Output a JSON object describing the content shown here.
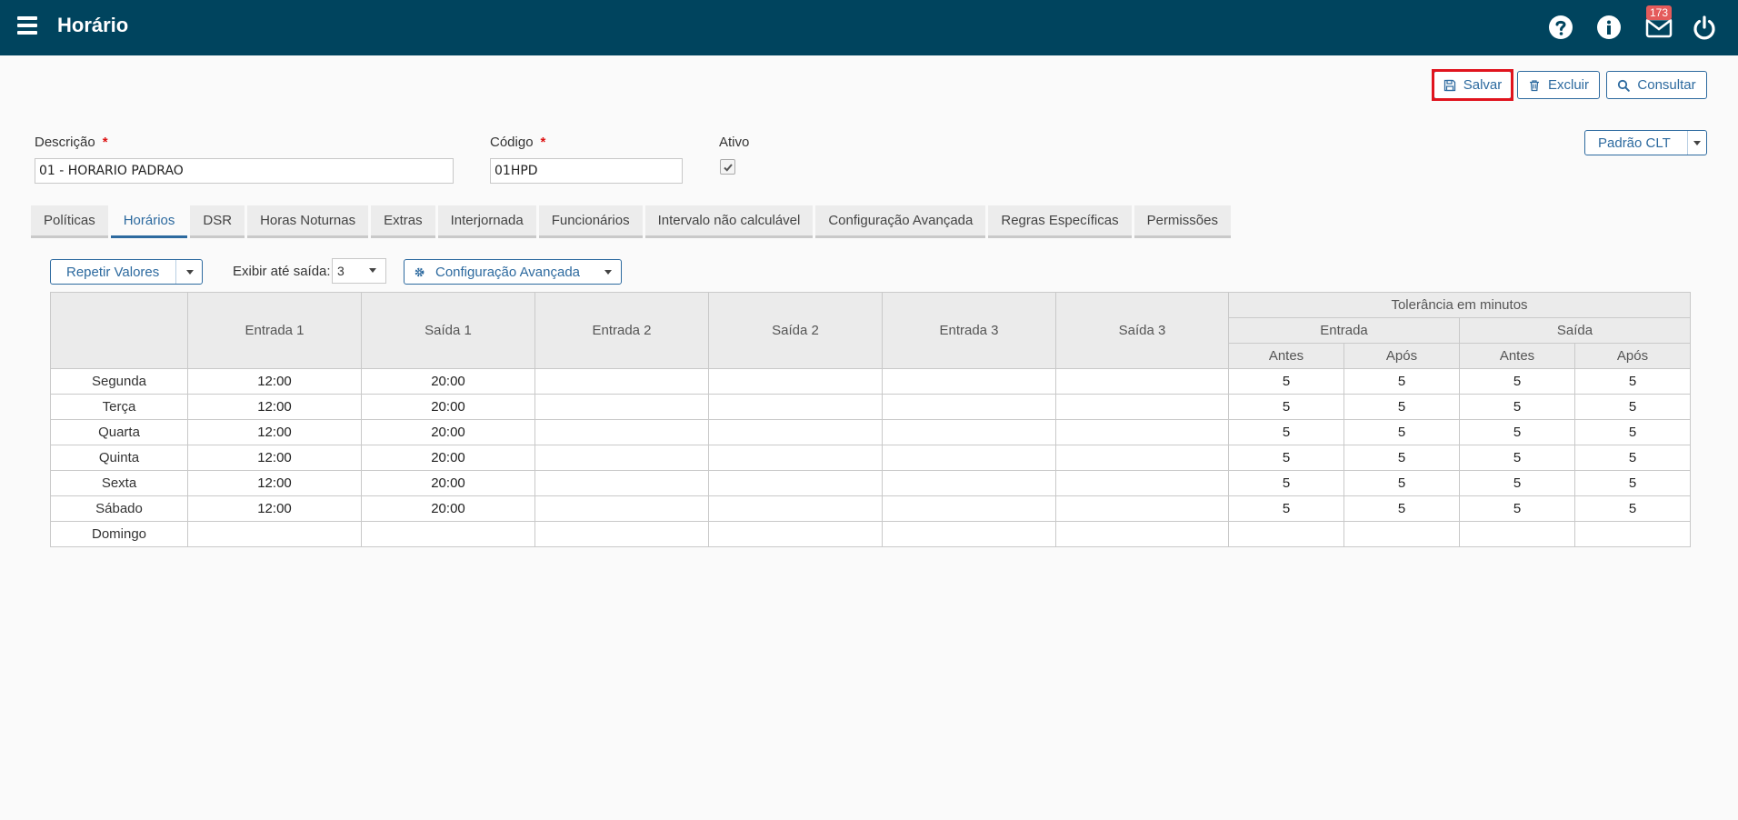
{
  "header": {
    "title": "Horário",
    "mail_count": "173"
  },
  "toolbar": {
    "save_label": "Salvar",
    "delete_label": "Excluir",
    "search_label": "Consultar"
  },
  "form": {
    "description_label": "Descrição",
    "description_value": "01 - HORARIO PADRAO",
    "code_label": "Código",
    "code_value": "01HPD",
    "active_label": "Ativo",
    "required_mark": "*",
    "template_select": "Padrão CLT"
  },
  "tabs": [
    "Políticas",
    "Horários",
    "DSR",
    "Horas Noturnas",
    "Extras",
    "Interjornada",
    "Funcionários",
    "Intervalo não calculável",
    "Configuração Avançada",
    "Regras Específicas",
    "Permissões"
  ],
  "schedule_toolbar": {
    "repeat_label": "Repetir Valores",
    "show_until_label": "Exibir até saída:",
    "show_until_value": "3",
    "advanced_label": "Configuração Avançada"
  },
  "table": {
    "columns": [
      "Entrada 1",
      "Saída 1",
      "Entrada 2",
      "Saída 2",
      "Entrada 3",
      "Saída 3"
    ],
    "tolerance_label": "Tolerância em minutos",
    "entry_label": "Entrada",
    "exit_label": "Saída",
    "before_label": "Antes",
    "after_label": "Após",
    "rows": [
      {
        "day": "Segunda",
        "cells": [
          "12:00",
          "20:00",
          "",
          "",
          "",
          "",
          "5",
          "5",
          "5",
          "5"
        ]
      },
      {
        "day": "Terça",
        "cells": [
          "12:00",
          "20:00",
          "",
          "",
          "",
          "",
          "5",
          "5",
          "5",
          "5"
        ]
      },
      {
        "day": "Quarta",
        "cells": [
          "12:00",
          "20:00",
          "",
          "",
          "",
          "",
          "5",
          "5",
          "5",
          "5"
        ]
      },
      {
        "day": "Quinta",
        "cells": [
          "12:00",
          "20:00",
          "",
          "",
          "",
          "",
          "5",
          "5",
          "5",
          "5"
        ]
      },
      {
        "day": "Sexta",
        "cells": [
          "12:00",
          "20:00",
          "",
          "",
          "",
          "",
          "5",
          "5",
          "5",
          "5"
        ]
      },
      {
        "day": "Sábado",
        "cells": [
          "12:00",
          "20:00",
          "",
          "",
          "",
          "",
          "5",
          "5",
          "5",
          "5"
        ]
      },
      {
        "day": "Domingo",
        "cells": [
          "",
          "",
          "",
          "",
          "",
          "",
          "",
          "",
          "",
          ""
        ]
      }
    ]
  },
  "icons": {
    "menu": "hamburger-icon",
    "help": "question-circle-icon",
    "info": "info-circle-icon",
    "mail": "envelope-icon",
    "power": "power-icon",
    "save": "floppy-disk-icon",
    "delete": "trash-icon",
    "search": "magnifier-icon",
    "gear": "gear-icon"
  },
  "colors": {
    "header": "#00445e",
    "accent": "#2d6a9f",
    "badge": "#e45b5b",
    "highlight": "#e0141e"
  }
}
